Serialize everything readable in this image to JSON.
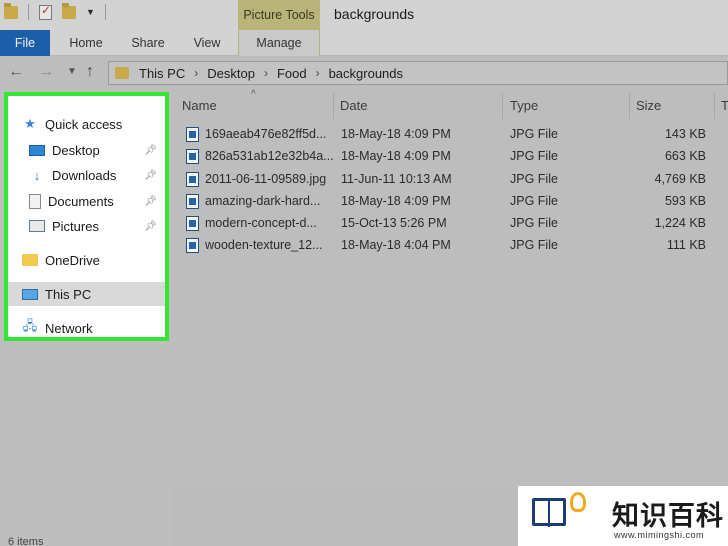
{
  "window": {
    "title": "backgrounds",
    "context_tab": "Picture Tools"
  },
  "ribbon": {
    "tabs": [
      "File",
      "Home",
      "Share",
      "View",
      "Manage"
    ]
  },
  "address": {
    "crumbs": [
      "This PC",
      "Desktop",
      "Food",
      "backgrounds"
    ]
  },
  "nav_pane": {
    "items": [
      {
        "label": "Quick access",
        "icon": "star-icon"
      },
      {
        "label": "Desktop",
        "icon": "desktop-icon",
        "pinned": true
      },
      {
        "label": "Downloads",
        "icon": "download-icon",
        "pinned": true
      },
      {
        "label": "Documents",
        "icon": "document-icon",
        "pinned": true
      },
      {
        "label": "Pictures",
        "icon": "pictures-icon",
        "pinned": true
      },
      {
        "label": "OneDrive",
        "icon": "folder-icon"
      },
      {
        "label": "This PC",
        "icon": "computer-icon",
        "selected": true
      },
      {
        "label": "Network",
        "icon": "network-icon"
      }
    ],
    "highlight_color": "#32e632"
  },
  "columns": [
    "Name",
    "Date",
    "Type",
    "Size",
    "T"
  ],
  "files": [
    {
      "name": "169aeab476e82ff5d...",
      "date": "18-May-18 4:09 PM",
      "type": "JPG File",
      "size": "143 KB"
    },
    {
      "name": "826a531ab12e32b4a...",
      "date": "18-May-18 4:09 PM",
      "type": "JPG File",
      "size": "663 KB"
    },
    {
      "name": "2011-06-11-09589.jpg",
      "date": "11-Jun-11 10:13 AM",
      "type": "JPG File",
      "size": "4,769 KB"
    },
    {
      "name": "amazing-dark-hard...",
      "date": "18-May-18 4:09 PM",
      "type": "JPG File",
      "size": "593 KB"
    },
    {
      "name": "modern-concept-d...",
      "date": "15-Oct-13 5:26 PM",
      "type": "JPG File",
      "size": "1,224 KB"
    },
    {
      "name": "wooden-texture_12...",
      "date": "18-May-18 4:04 PM",
      "type": "JPG File",
      "size": "111 KB"
    }
  ],
  "status": {
    "items_text": "6 items"
  },
  "watermark": {
    "text": "知识百科",
    "url": "www.mimingshi.com"
  },
  "colors": {
    "file_tab": "#1c5fa8",
    "context_tab": "#b9b47a"
  }
}
